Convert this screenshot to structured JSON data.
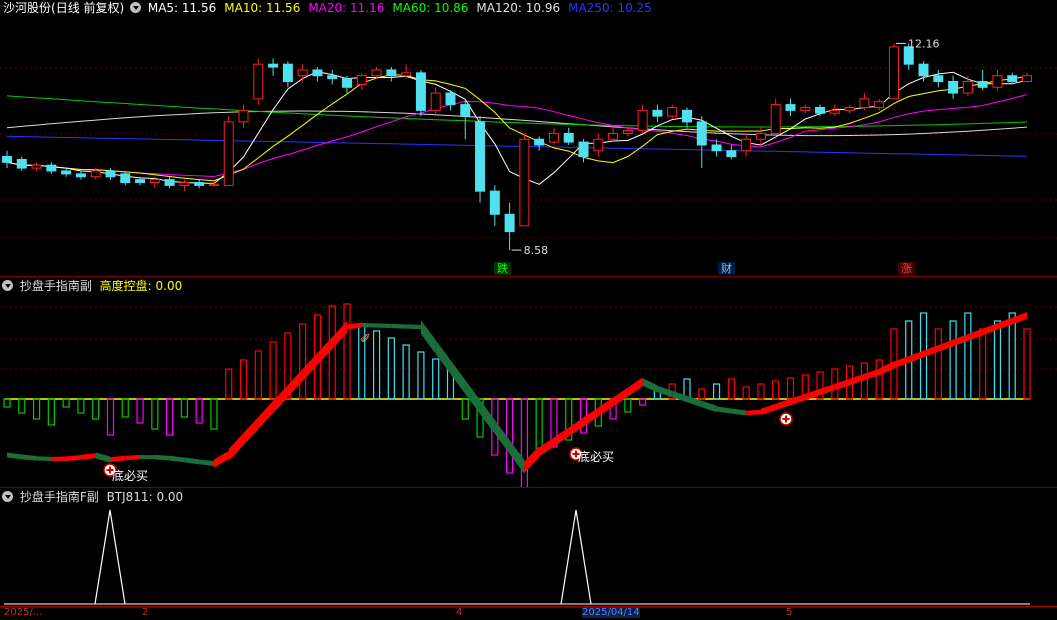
{
  "main_panel": {
    "stock_name": "沙河股份",
    "mode": "(日线 前复权)",
    "indicators": [
      {
        "label": "MA5: 11.56",
        "color": "#ffffff"
      },
      {
        "label": "MA10: 11.56",
        "color": "#ffff00"
      },
      {
        "label": "MA20: 11.16",
        "color": "#ff00ff"
      },
      {
        "label": "MA60: 10.86",
        "color": "#00ff00"
      },
      {
        "label": "MA120: 10.96",
        "color": "#e0e0e0"
      },
      {
        "label": "MA250: 10.25",
        "color": "#3030ff"
      }
    ],
    "high_label": "12.16",
    "low_label": "8.58",
    "events": [
      {
        "text": "跌",
        "color": "#00ff00",
        "bg": "#003300"
      },
      {
        "text": "财",
        "color": "#80c0ff",
        "bg": "#001a40"
      },
      {
        "text": "涨",
        "color": "#ff4040",
        "bg": "#400000"
      }
    ]
  },
  "sub_panel_1": {
    "title": "抄盘手指南副",
    "indicator_label": "高度控盘:",
    "indicator_value": "0.00",
    "signal_text": "底必买",
    "colors": {
      "up": "#ff0000",
      "down": "#1a6e3a",
      "cyan": "#40e0f0",
      "magenta": "#ff00ff",
      "green": "#00cc00",
      "yellow": "#ffff00"
    }
  },
  "sub_panel_2": {
    "title": "抄盘手指南F副",
    "indicator_label": "BTJ811:",
    "indicator_value": "0.00"
  },
  "x_axis": {
    "labels": [
      "2025/...",
      "2",
      "4",
      "2025/04/14",
      "5"
    ]
  },
  "chart_data": {
    "type": "candlestick",
    "price_range": [
      8.2,
      12.6
    ],
    "candles": [
      [
        10.2,
        10.1,
        10.3,
        10.0
      ],
      [
        10.15,
        10.0,
        10.2,
        9.95
      ],
      [
        10.0,
        10.05,
        10.1,
        9.95
      ],
      [
        10.05,
        9.95,
        10.1,
        9.9
      ],
      [
        9.95,
        9.9,
        10.0,
        9.85
      ],
      [
        9.9,
        9.85,
        9.95,
        9.8
      ],
      [
        9.85,
        9.95,
        10.0,
        9.8
      ],
      [
        9.95,
        9.85,
        10.0,
        9.8
      ],
      [
        9.9,
        9.75,
        9.95,
        9.7
      ],
      [
        9.8,
        9.75,
        9.85,
        9.7
      ],
      [
        9.75,
        9.8,
        9.85,
        9.65
      ],
      [
        9.8,
        9.7,
        9.85,
        9.65
      ],
      [
        9.7,
        9.75,
        9.8,
        9.6
      ],
      [
        9.75,
        9.7,
        9.8,
        9.65
      ],
      [
        9.7,
        9.72,
        9.78,
        9.68
      ],
      [
        9.7,
        10.8,
        10.9,
        9.7
      ],
      [
        10.8,
        11.0,
        11.1,
        10.7
      ],
      [
        11.2,
        11.8,
        11.9,
        11.1
      ],
      [
        11.8,
        11.75,
        11.9,
        11.6
      ],
      [
        11.8,
        11.5,
        11.85,
        11.4
      ],
      [
        11.6,
        11.7,
        11.8,
        11.5
      ],
      [
        11.7,
        11.6,
        11.75,
        11.5
      ],
      [
        11.6,
        11.55,
        11.7,
        11.45
      ],
      [
        11.55,
        11.4,
        11.6,
        11.3
      ],
      [
        11.45,
        11.6,
        11.65,
        11.35
      ],
      [
        11.6,
        11.7,
        11.75,
        11.55
      ],
      [
        11.7,
        11.6,
        11.75,
        11.5
      ],
      [
        11.6,
        11.65,
        11.8,
        11.55
      ],
      [
        11.65,
        11.0,
        11.7,
        10.9
      ],
      [
        11.0,
        11.3,
        11.4,
        10.9
      ],
      [
        11.3,
        11.1,
        11.35,
        11.0
      ],
      [
        11.1,
        10.9,
        11.2,
        10.5
      ],
      [
        10.8,
        9.6,
        10.9,
        9.4
      ],
      [
        9.6,
        9.2,
        9.7,
        9.0
      ],
      [
        9.2,
        8.9,
        9.4,
        8.58
      ],
      [
        9.0,
        10.5,
        10.6,
        9.0
      ],
      [
        10.5,
        10.4,
        10.55,
        10.3
      ],
      [
        10.45,
        10.6,
        10.7,
        10.4
      ],
      [
        10.6,
        10.45,
        10.7,
        10.4
      ],
      [
        10.45,
        10.2,
        10.5,
        10.1
      ],
      [
        10.3,
        10.5,
        10.6,
        10.2
      ],
      [
        10.5,
        10.6,
        10.7,
        10.45
      ],
      [
        10.6,
        10.65,
        10.7,
        10.55
      ],
      [
        10.65,
        11.0,
        11.1,
        10.6
      ],
      [
        11.0,
        10.9,
        11.1,
        10.8
      ],
      [
        10.9,
        11.05,
        11.1,
        10.85
      ],
      [
        11.0,
        10.8,
        11.05,
        10.7
      ],
      [
        10.8,
        10.4,
        10.9,
        10.0
      ],
      [
        10.4,
        10.3,
        10.5,
        10.2
      ],
      [
        10.3,
        10.2,
        10.4,
        10.15
      ],
      [
        10.3,
        10.5,
        10.6,
        10.2
      ],
      [
        10.5,
        10.6,
        10.7,
        10.4
      ],
      [
        10.6,
        11.1,
        11.2,
        10.5
      ],
      [
        11.1,
        11.0,
        11.2,
        10.9
      ],
      [
        11.0,
        11.05,
        11.1,
        10.95
      ],
      [
        11.05,
        10.95,
        11.1,
        10.9
      ],
      [
        10.95,
        11.0,
        11.1,
        10.9
      ],
      [
        11.0,
        11.05,
        11.1,
        10.95
      ],
      [
        11.05,
        11.2,
        11.3,
        11.0
      ],
      [
        11.05,
        11.15,
        11.2,
        11.0
      ],
      [
        11.2,
        12.1,
        12.16,
        11.2
      ],
      [
        12.1,
        11.8,
        12.16,
        11.7
      ],
      [
        11.8,
        11.6,
        11.85,
        11.5
      ],
      [
        11.6,
        11.5,
        11.7,
        11.4
      ],
      [
        11.5,
        11.3,
        11.6,
        11.2
      ],
      [
        11.3,
        11.5,
        11.6,
        11.25
      ],
      [
        11.5,
        11.4,
        11.7,
        11.35
      ],
      [
        11.4,
        11.6,
        11.7,
        11.35
      ],
      [
        11.6,
        11.5,
        11.65,
        11.45
      ],
      [
        11.5,
        11.6,
        11.65,
        11.5
      ]
    ]
  }
}
